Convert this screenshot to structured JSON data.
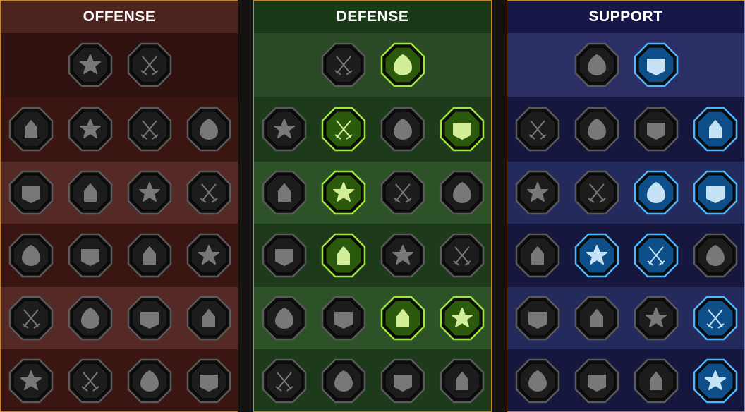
{
  "panels": [
    {
      "title": "OFFENSE",
      "theme": "offense",
      "colors": {
        "title_bg": "#4d2420",
        "row_a": "#3a1512",
        "row_b": "#552926",
        "row_top": "#2f1210"
      },
      "rows": [
        [
          {
            "icon": "crossed-swords-icon",
            "active": false
          },
          {
            "icon": "triple-claw-slash-icon",
            "active": false
          }
        ],
        [
          {
            "icon": "horned-demon-icon",
            "active": false
          },
          {
            "icon": "sword-slash-icon",
            "active": false
          },
          {
            "icon": "shield-pierce-icon",
            "active": false
          },
          {
            "icon": "pierced-heart-icon",
            "active": false
          }
        ],
        [
          {
            "icon": "arrow-volley-icon",
            "active": false
          },
          {
            "icon": "fanged-jaw-icon",
            "active": false
          },
          {
            "icon": "skull-slash-icon",
            "active": false
          },
          {
            "icon": "reaper-scythe-icon",
            "active": false
          }
        ],
        [
          {
            "icon": "bleeding-blade-icon",
            "active": false
          },
          {
            "icon": "gripping-fist-icon",
            "active": false
          },
          {
            "icon": "double-axe-icon",
            "active": false
          },
          {
            "icon": "lightning-chains-icon",
            "active": false
          }
        ],
        [
          {
            "icon": "swords-in-ground-icon",
            "active": false
          },
          {
            "icon": "skull-pile-icon",
            "active": false
          },
          {
            "icon": "dagger-ring-icon",
            "active": false
          },
          {
            "icon": "shocked-warrior-icon",
            "active": false
          }
        ],
        [
          {
            "icon": "sparkling-sword-icon",
            "active": false
          },
          {
            "icon": "knight-helm-icon",
            "active": false
          },
          {
            "icon": "beast-brute-icon",
            "active": false
          },
          {
            "icon": "spiked-skull-icon",
            "active": false
          }
        ]
      ]
    },
    {
      "title": "DEFENSE",
      "theme": "defense",
      "colors": {
        "title_bg": "#1a3a17",
        "row_a": "#1d3a1a",
        "row_b": "#2e5228",
        "row_top": "#2a4a25"
      },
      "rows": [
        [
          {
            "icon": "brick-wall-icon",
            "active": false
          },
          {
            "icon": "raised-fist-icon",
            "active": true
          }
        ],
        [
          {
            "icon": "layered-shield-icon",
            "active": false
          },
          {
            "icon": "armored-heart-icon",
            "active": true
          },
          {
            "icon": "stone-golem-icon",
            "active": false
          },
          {
            "icon": "crossed-blades-shield-icon",
            "active": true
          }
        ],
        [
          {
            "icon": "warrior-guard-icon",
            "active": false
          },
          {
            "icon": "knight-shield-icon",
            "active": true
          },
          {
            "icon": "skull-heart-icon",
            "active": false
          },
          {
            "icon": "halo-figure-icon",
            "active": false
          }
        ],
        [
          {
            "icon": "crowd-figures-icon",
            "active": false
          },
          {
            "icon": "hourglass-burst-icon",
            "active": true
          },
          {
            "icon": "open-palm-icon",
            "active": false
          },
          {
            "icon": "bull-head-icon",
            "active": false
          }
        ],
        [
          {
            "icon": "dashing-runner-icon",
            "active": false
          },
          {
            "icon": "spiked-crown-icon",
            "active": false
          },
          {
            "icon": "radiant-skull-icon",
            "active": true
          },
          {
            "icon": "grasping-hand-icon",
            "active": true
          }
        ],
        [
          {
            "icon": "spiked-armor-icon",
            "active": false
          },
          {
            "icon": "winged-shield-icon",
            "active": false
          },
          {
            "icon": "hooded-skull-icon",
            "active": false
          },
          {
            "icon": "flexing-giant-icon",
            "active": false
          }
        ]
      ]
    },
    {
      "title": "SUPPORT",
      "theme": "support",
      "colors": {
        "title_bg": "#151846",
        "row_a": "#15173f",
        "row_b": "#252a5c",
        "row_top": "#2b2f66"
      },
      "rows": [
        [
          {
            "icon": "heart-plus-icon",
            "active": false
          },
          {
            "icon": "clawed-orb-icon",
            "active": true
          }
        ],
        [
          {
            "icon": "praying-hands-icon",
            "active": false
          },
          {
            "icon": "radiant-shield-icon",
            "active": false
          },
          {
            "icon": "flaming-skull-icon",
            "active": false
          },
          {
            "icon": "shattered-blade-icon",
            "active": true
          }
        ],
        [
          {
            "icon": "sparkle-figure-icon",
            "active": false
          },
          {
            "icon": "lightning-shield-icon",
            "active": false
          },
          {
            "icon": "cracked-ground-icon",
            "active": true
          },
          {
            "icon": "twin-figures-icon",
            "active": true
          }
        ],
        [
          {
            "icon": "chained-heart-icon",
            "active": false
          },
          {
            "icon": "comet-icon",
            "active": true
          },
          {
            "icon": "open-book-icon",
            "active": true
          },
          {
            "icon": "angry-eyes-icon",
            "active": false
          }
        ],
        [
          {
            "icon": "compass-star-icon",
            "active": false
          },
          {
            "icon": "swift-boot-icon",
            "active": false
          },
          {
            "icon": "all-seeing-eye-icon",
            "active": false
          },
          {
            "icon": "voodoo-doll-icon",
            "active": true
          }
        ],
        [
          {
            "icon": "poison-flask-icon",
            "active": false
          },
          {
            "icon": "winged-skull-icon",
            "active": false
          },
          {
            "icon": "cursed-hand-icon",
            "active": false
          },
          {
            "icon": "eagle-head-icon",
            "active": true
          }
        ]
      ]
    }
  ],
  "styles": {
    "inactive": {
      "rim": "#5a5a5a",
      "fill": "#1c1c1c",
      "glyph": "#828282"
    },
    "defense_active": {
      "rim": "#9fe63a",
      "fill": "#2c5a0c",
      "glyph": "#e6ffa8"
    },
    "support_active": {
      "rim": "#4cb6ff",
      "fill": "#0e4f8a",
      "glyph": "#d8f2ff"
    }
  }
}
